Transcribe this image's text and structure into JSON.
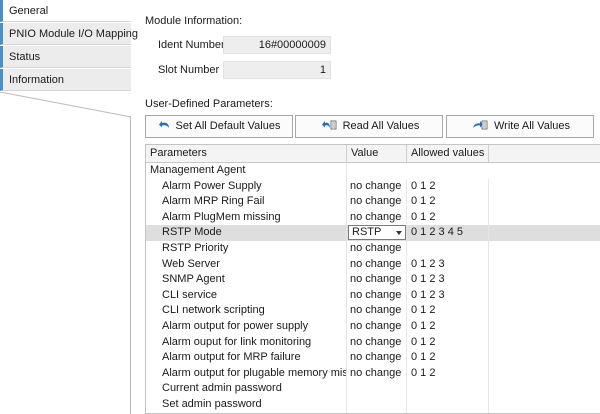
{
  "nav": {
    "items": [
      {
        "label": "General",
        "active": true
      },
      {
        "label": "PNIO Module I/O Mapping",
        "active": false
      },
      {
        "label": "Status",
        "active": false
      },
      {
        "label": "Information",
        "active": false
      }
    ]
  },
  "module_info": {
    "heading": "Module Information:",
    "ident_label": "Ident Number",
    "ident_value": "16#00000009",
    "slot_label": "Slot Number",
    "slot_value": "1"
  },
  "user_params": {
    "heading": "User-Defined Parameters:",
    "buttons": {
      "set_defaults": "Set All Default Values",
      "read_all": "Read All Values",
      "write_all": "Write All Values"
    }
  },
  "table": {
    "headers": {
      "parameters": "Parameters",
      "value": "Value",
      "allowed": "Allowed values"
    },
    "rows": [
      {
        "param": "Management Agent",
        "value": "",
        "allowed": "",
        "group": true
      },
      {
        "param": "Alarm Power Supply",
        "value": "no change",
        "allowed": "0 1 2"
      },
      {
        "param": "Alarm MRP Ring Fail",
        "value": "no change",
        "allowed": "0 1 2"
      },
      {
        "param": "Alarm PlugMem missing",
        "value": "no change",
        "allowed": "0 1 2"
      },
      {
        "param": "RSTP Mode",
        "value": "RSTP",
        "allowed": "0 1 2 3 4 5",
        "dropdown": true
      },
      {
        "param": "RSTP Priority",
        "value": "no change",
        "allowed": ""
      },
      {
        "param": "Web Server",
        "value": "no change",
        "allowed": "0 1 2 3"
      },
      {
        "param": "SNMP Agent",
        "value": "no change",
        "allowed": "0 1 2 3"
      },
      {
        "param": "CLI service",
        "value": "no change",
        "allowed": "0 1 2 3"
      },
      {
        "param": "CLI network scripting",
        "value": "no change",
        "allowed": "0 1 2"
      },
      {
        "param": "Alarm output for power supply",
        "value": "no change",
        "allowed": "0 1 2"
      },
      {
        "param": "Alarm ouput for link monitoring",
        "value": "no change",
        "allowed": "0 1 2"
      },
      {
        "param": "Alarm output for MRP failure",
        "value": "no change",
        "allowed": "0 1 2"
      },
      {
        "param": "Alarm output for plugable memory missing",
        "value": "no change",
        "allowed": "0 1 2"
      },
      {
        "param": "Current admin password",
        "value": "",
        "allowed": ""
      },
      {
        "param": "Set admin password",
        "value": "",
        "allowed": ""
      }
    ]
  },
  "icons": {
    "set_defaults": "reset-arrow-icon",
    "read_all": "read-arrow-icon",
    "write_all": "write-arrow-icon",
    "dropdown": "chevron-down-icon"
  },
  "colors": {
    "nav_accent": "#4a8fc6",
    "icon_blue": "#2a6db5",
    "row_highlight": "#dedede"
  }
}
